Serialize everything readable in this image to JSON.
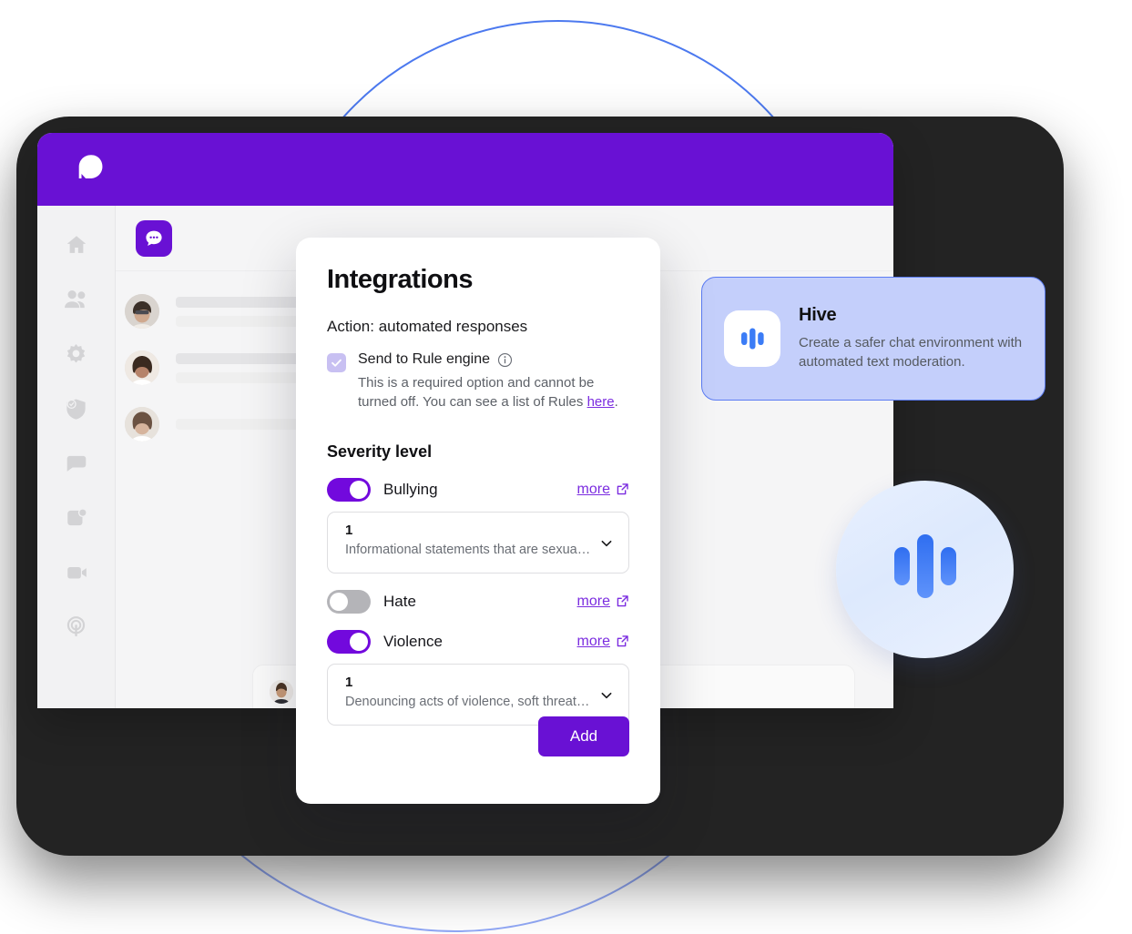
{
  "app": {
    "logo_icon": "speech-bubble-logo",
    "header_color": "#6911d4",
    "chat_tile_icon": "chat-dots-icon",
    "sidebar": {
      "items": [
        {
          "icon": "home-icon",
          "name": "home"
        },
        {
          "icon": "people-icon",
          "name": "users"
        },
        {
          "icon": "gear-icon",
          "name": "settings"
        },
        {
          "icon": "shield-check-icon",
          "name": "moderation"
        },
        {
          "icon": "chat-bubble-icon",
          "name": "chat"
        },
        {
          "icon": "media-icon",
          "name": "media"
        },
        {
          "icon": "video-camera-icon",
          "name": "video"
        },
        {
          "icon": "broadcast-icon",
          "name": "broadcast"
        }
      ]
    }
  },
  "modal": {
    "title": "Integrations",
    "action_label": "Action: automated responses",
    "required_option": {
      "checked": true,
      "label": "Send to Rule engine",
      "info_icon": "info-icon",
      "description_before": "This is a required option and cannot be turned off. You can see a list of Rules ",
      "link_text": "here",
      "description_after": "."
    },
    "severity_label": "Severity level",
    "severity_rows": [
      {
        "name": "Bullying",
        "enabled": true,
        "more_label": "more",
        "more_icon": "external-link-icon",
        "select": {
          "value": "1",
          "description": "Informational statements that are sexual i…"
        }
      },
      {
        "name": "Hate",
        "enabled": false,
        "more_label": "more",
        "more_icon": "external-link-icon",
        "select": null
      },
      {
        "name": "Violence",
        "enabled": true,
        "more_label": "more",
        "more_icon": "external-link-icon",
        "select": {
          "value": "1",
          "description": "Denouncing acts of violence, soft threats…"
        }
      }
    ],
    "add_button_label": "Add"
  },
  "hive_card": {
    "icon": "hive-logo-icon",
    "title": "Hive",
    "description": "Create a safer chat environment with automated text moderation."
  },
  "hive_badge": {
    "icon": "hive-logo-icon"
  },
  "colors": {
    "brand_purple": "#6911d4",
    "toggle_on": "#7209dd",
    "toggle_off": "#b4b4b8",
    "link_purple": "#7b2ce0",
    "checkbox_lavender": "#c8c0f2",
    "hive_card_bg": "#c4cffb",
    "hive_card_border": "#5b7cf3",
    "hive_blue": "#3b7cf6",
    "deco_circle_blue": "#4272ee",
    "device_shadow": "#232323"
  }
}
